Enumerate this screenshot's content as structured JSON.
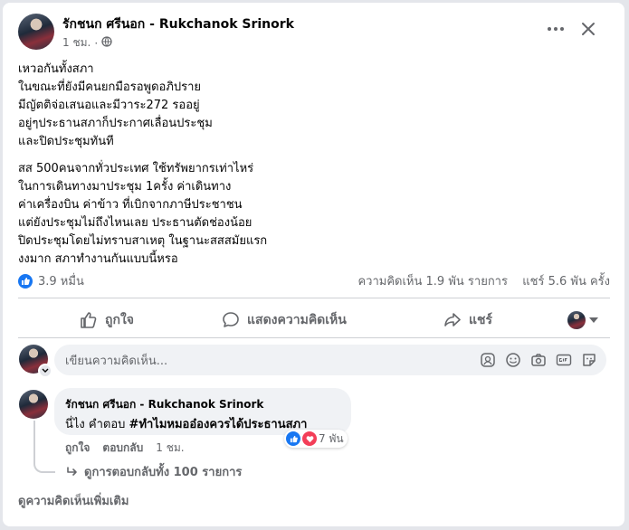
{
  "post": {
    "author": "รักชนก ศรีนอก - Rukchanok Srinork",
    "time": "1 ชม.",
    "visibility_icon": "globe-icon",
    "paragraphs": [
      "เหวอกันทั้งสภา\nในขณะที่ยังมีคนยกมือรอพูดอภิปราย\nมีญัตติจ่อเสนอและมีวาระ272 รออยู่\nอยู่ๆประธานสภาก็ประกาศเลื่อนประชุม\nและปิดประชุมทันที",
      "สส 500คนจากทั่วประเทศ ใช้ทรัพยากรเท่าไหร่\nในการเดินทางมาประชุม 1ครั้ง ค่าเดินทาง\nค่าเครื่องบิน ค่าข้าว ที่เบิกจากภาษีประชาชน\nแต่ยังประชุมไม่ถึงไหนเลย ประธานตัดช่องน้อย\nปิดประชุมโดยไม่ทราบสาเหตุ ในฐานะสสสมัยแรก\nงงมาก สภาทำงานกันแบบนี้หรอ"
    ]
  },
  "stats": {
    "reactions_count": "3.9 หมื่น",
    "comments": "ความคิดเห็น 1.9 พัน รายการ",
    "shares": "แชร์ 5.6 พัน ครั้ง"
  },
  "actions": {
    "like": "ถูกใจ",
    "comment": "แสดงความคิดเห็น",
    "share": "แชร์"
  },
  "composer": {
    "placeholder": "เขียนความคิดเห็น..."
  },
  "comment": {
    "author": "รักชนก ศรีนอก - Rukchanok Srinork",
    "text_prefix": "นี่ไง คำตอบ ",
    "hashtag": "#ทำไมหมออ๋องควรได้ประธานสภา",
    "reaction_count": "7 พัน",
    "like": "ถูกใจ",
    "reply": "ตอบกลับ",
    "time": "1 ชม.",
    "view_replies": "ดูการตอบกลับทั้ง 100 รายการ"
  },
  "more_comments": "ดูความคิดเห็นเพิ่มเติม",
  "colors": {
    "like_blue": "#1877f2",
    "love_red": "#f33e58",
    "secondary_text": "#65676b"
  }
}
